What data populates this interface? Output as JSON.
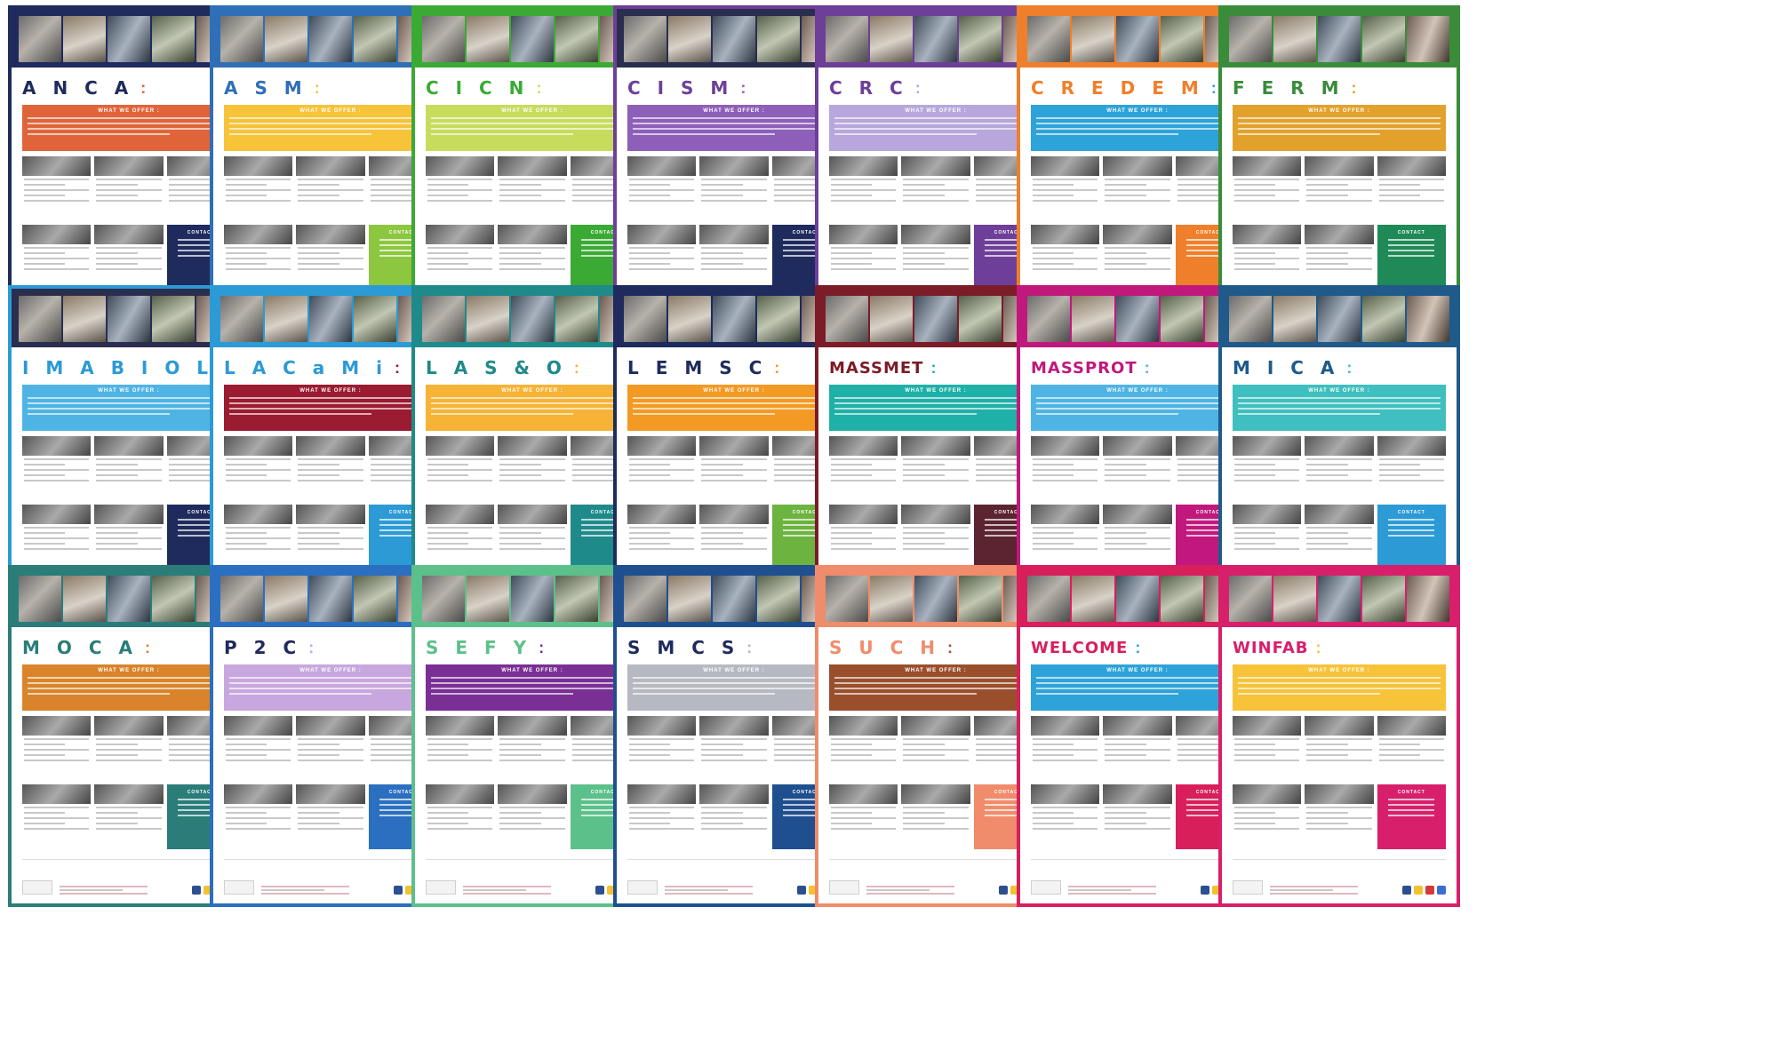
{
  "offer_title": "WHAT WE OFFER :",
  "contact_title": "CONTACT",
  "posters": [
    {
      "acronym": "A N C A",
      "border": "#1f2b5c",
      "header": "#1f2b5c",
      "accent": "#e0643a",
      "contact": "#1f2b5c"
    },
    {
      "acronym": "A S M",
      "border": "#2e6fb7",
      "header": "#2e6fb7",
      "accent": "#f6c339",
      "contact": "#8dc63f"
    },
    {
      "acronym": "C I C N",
      "border": "#3aaa35",
      "header": "#3aaa35",
      "accent": "#c7dc5c",
      "contact": "#3aaa35"
    },
    {
      "acronym": "C I S M",
      "border": "#6d3f98",
      "header": "#2b2d4f",
      "accent": "#8e5fb9",
      "contact": "#1f2b5c"
    },
    {
      "acronym": "C R C",
      "border": "#6d3f98",
      "header": "#6d3f98",
      "accent": "#b7a7dd",
      "contact": "#6d3f98"
    },
    {
      "acronym": "C R E D E M",
      "border": "#ef7f2a",
      "header": "#ef7f2a",
      "accent": "#2ea3d9",
      "contact": "#ef7f2a"
    },
    {
      "acronym": "F E R M",
      "border": "#3a8c3a",
      "header": "#3a8c3a",
      "accent": "#e2a12b",
      "contact": "#1f8a57"
    },
    {
      "acronym": "I M A B I O L",
      "border": "#2b9ad5",
      "header": "#2b2d4f",
      "accent": "#4fb4e4",
      "contact": "#1f2b5c"
    },
    {
      "acronym": "L A C a M i",
      "border": "#2b9ad5",
      "header": "#2b9ad5",
      "accent": "#9b1b30",
      "contact": "#2b9ad5"
    },
    {
      "acronym": "L A S & O",
      "border": "#1f8a8a",
      "header": "#1f8a8a",
      "accent": "#f6b335",
      "contact": "#1f8a8a"
    },
    {
      "acronym": "L E M S C",
      "border": "#1f2b5c",
      "header": "#1f2b5c",
      "accent": "#f39a24",
      "contact": "#6cb33f"
    },
    {
      "acronym": "MASSMET",
      "border": "#7b1c28",
      "header": "#7b1c28",
      "accent": "#1fb0a8",
      "contact": "#5b2430"
    },
    {
      "acronym": "MASSPROT",
      "border": "#c1187d",
      "header": "#c1187d",
      "accent": "#4fb4e4",
      "contact": "#c1187d"
    },
    {
      "acronym": "M I C A",
      "border": "#1f5a8a",
      "header": "#1f5a8a",
      "accent": "#3fbfbf",
      "contact": "#2b9ad5"
    },
    {
      "acronym": "M O C A",
      "border": "#2a7d79",
      "header": "#2a7d79",
      "accent": "#d9842a",
      "contact": "#2a7d79"
    },
    {
      "acronym": "P 2 C",
      "border": "#2b6fc1",
      "header": "#2b6fc1",
      "accent": "#c8a7de",
      "contact": "#2b6fc1"
    },
    {
      "acronym": "S E F Y",
      "border": "#5cc08a",
      "header": "#5cc08a",
      "accent": "#7a2f95",
      "contact": "#5cc08a"
    },
    {
      "acronym": "S M C S",
      "border": "#1f4f8f",
      "header": "#1f4f8f",
      "accent": "#b7b9c2",
      "contact": "#1f4f8f"
    },
    {
      "acronym": "S U C H",
      "border": "#f08c6c",
      "header": "#f08c6c",
      "accent": "#9a4f2c",
      "contact": "#f08c6c"
    },
    {
      "acronym": "WELCOME",
      "border": "#d81f5c",
      "header": "#d81f5c",
      "accent": "#2ea3d9",
      "contact": "#d81f5c"
    },
    {
      "acronym": "WINFAB",
      "border": "#d81f6c",
      "header": "#d81f6c",
      "accent": "#f6c339",
      "contact": "#d81f6c"
    }
  ]
}
